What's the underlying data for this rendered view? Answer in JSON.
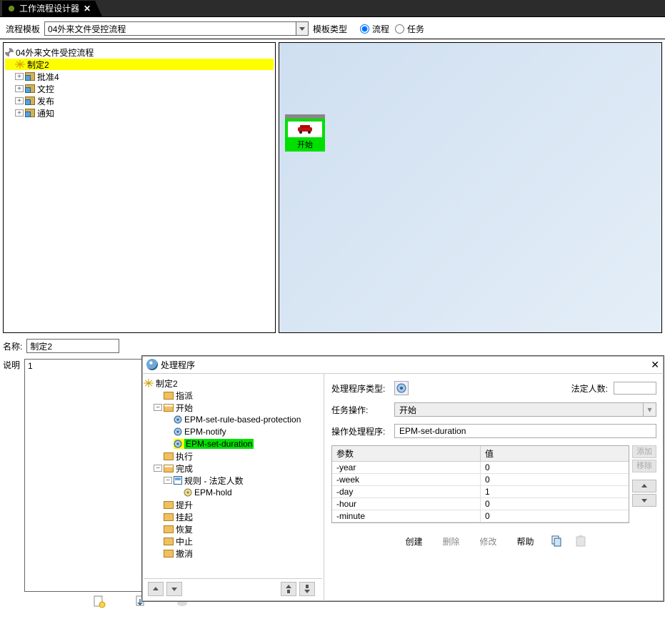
{
  "tab": {
    "title": "工作流程设计器",
    "close": "✕"
  },
  "top": {
    "template_label": "流程模板",
    "template_value": "04外来文件受控流程",
    "type_label": "模板类型",
    "radio_process": "流程",
    "radio_task": "任务"
  },
  "tree": {
    "root": "04外来文件受控流程",
    "selected": "制定2",
    "items": [
      "批准4",
      "文控",
      "发布",
      "通知"
    ]
  },
  "canvas": {
    "start_label": "开始"
  },
  "name": {
    "label": "名称:",
    "value": "制定2"
  },
  "desc": {
    "label": "说明",
    "value": "1"
  },
  "dialog": {
    "title": "处理程序",
    "close": "✕",
    "tree": {
      "root": "制定2",
      "assign": "指派",
      "start": "开始",
      "start_children": [
        "EPM-set-rule-based-protection",
        "EPM-notify",
        "EPM-set-duration"
      ],
      "execute": "执行",
      "complete": "完成",
      "rule": "规则 - 法定人数",
      "rule_child": "EPM-hold",
      "others": [
        "提升",
        "挂起",
        "恢复",
        "中止",
        "撤消"
      ]
    },
    "right": {
      "type_label": "处理程序类型:",
      "quorum_label": "法定人数:",
      "task_op_label": "任务操作:",
      "task_op_value": "开始",
      "handler_label": "操作处理程序:",
      "handler_value": "EPM-set-duration",
      "col_param": "参数",
      "col_value": "值",
      "rows": [
        {
          "p": "-year",
          "v": "0"
        },
        {
          "p": "-week",
          "v": "0"
        },
        {
          "p": "-day",
          "v": "1"
        },
        {
          "p": "-hour",
          "v": "0"
        },
        {
          "p": "-minute",
          "v": "0"
        }
      ],
      "add": "添加",
      "remove": "移除",
      "create": "创建",
      "delete": "删除",
      "modify": "修改",
      "help": "帮助"
    }
  }
}
